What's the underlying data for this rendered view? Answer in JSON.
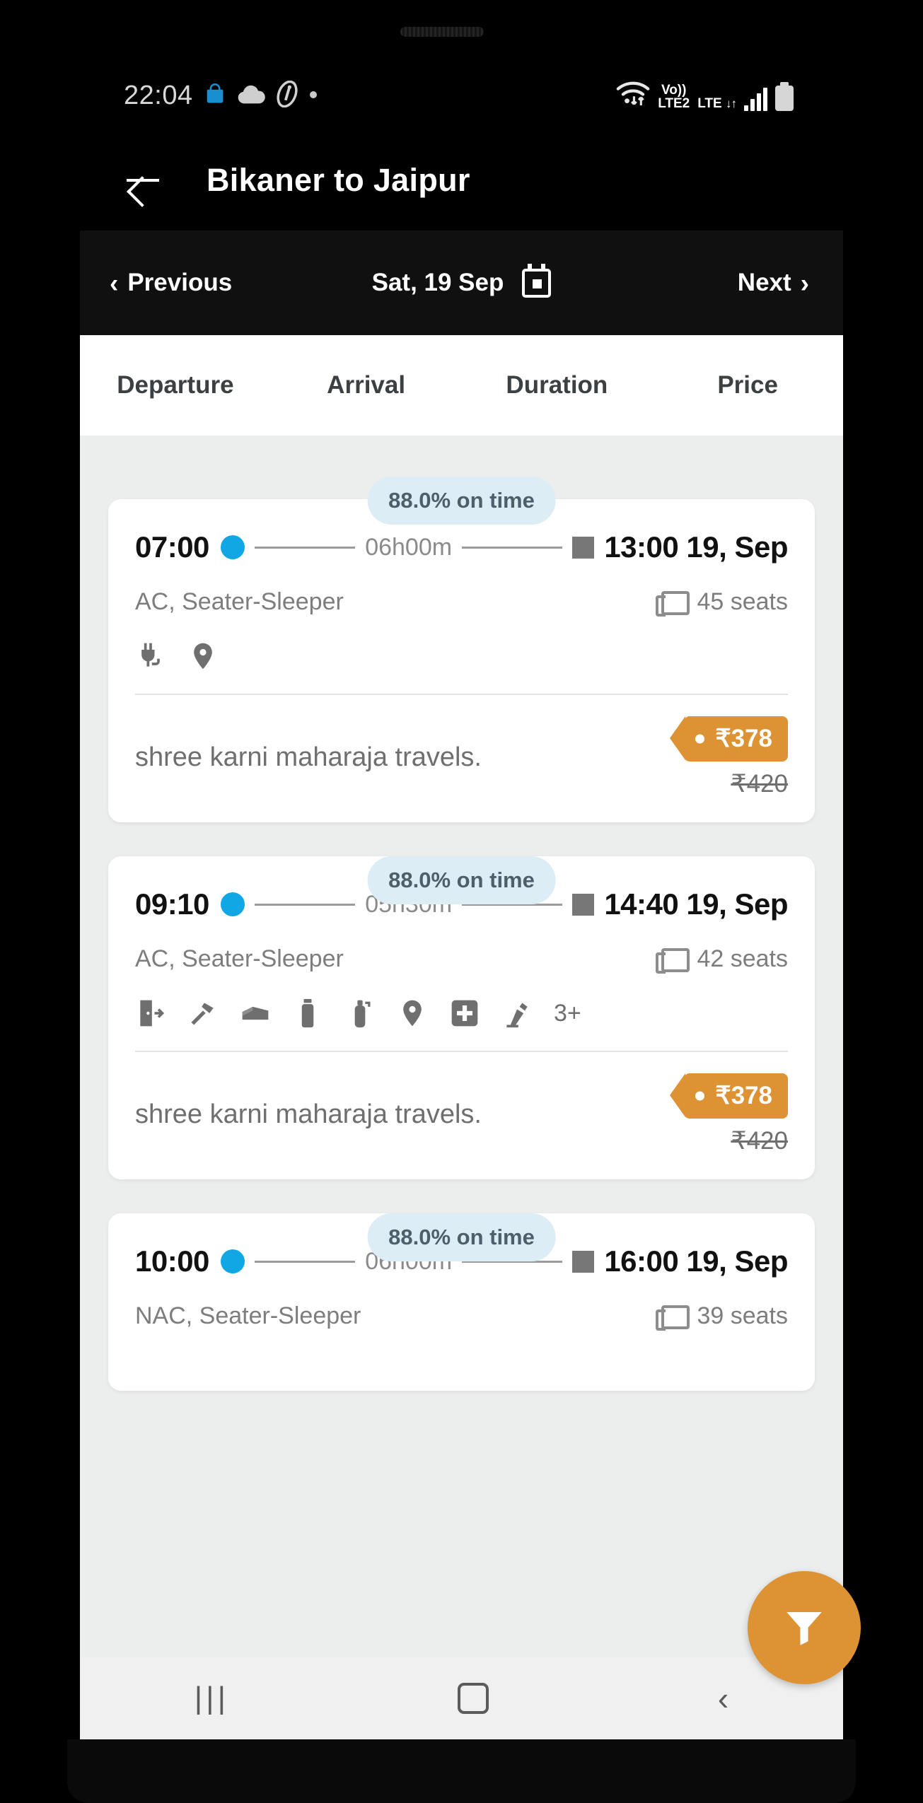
{
  "status_bar": {
    "time": "22:04",
    "left_icons": [
      "shopping-bag-icon",
      "cloud-icon",
      "brand-icon",
      "dot-icon"
    ],
    "right_icons": [
      "wifi-icon",
      "volte-icon",
      "lte-icon",
      "signal-bars-icon",
      "battery-icon"
    ],
    "volte_line1": "Vo))",
    "volte_line2": "LTE2",
    "lte_label": "LTE",
    "lte_arrows": "↓↑",
    "wifi_arrows": "↓↑"
  },
  "app_bar": {
    "back_icon": "back-arrow-icon",
    "title": "Bikaner to Jaipur"
  },
  "date_bar": {
    "previous_label": "Previous",
    "previous_chevron": "‹",
    "date_label": "Sat, 19 Sep",
    "calendar_icon": "calendar-icon",
    "next_label": "Next",
    "next_chevron": "›"
  },
  "sort_tabs": [
    {
      "label": "Departure"
    },
    {
      "label": "Arrival"
    },
    {
      "label": "Duration"
    },
    {
      "label": "Price"
    }
  ],
  "buses": [
    {
      "on_time_badge": "88.0% on time",
      "departure_time": "07:00",
      "duration": "06h00m",
      "arrival_time": "13:00 19, Sep",
      "bus_type": "AC, Seater-Sleeper",
      "seats": "45 seats",
      "amenities": [
        "charging-point-icon",
        "live-tracking-icon"
      ],
      "amenities_more": "",
      "operator": "shree karni maharaja travels.",
      "price": "₹378",
      "original_price": "₹420"
    },
    {
      "on_time_badge": "88.0% on time",
      "departure_time": "09:10",
      "duration": "05h30m",
      "arrival_time": "14:40 19, Sep",
      "bus_type": "AC, Seater-Sleeper",
      "seats": "42 seats",
      "amenities": [
        "emergency-exit-icon",
        "hammer-icon",
        "blanket-icon",
        "water-bottle-icon",
        "fire-extinguisher-icon",
        "live-tracking-icon",
        "first-aid-icon",
        "reading-light-icon"
      ],
      "amenities_more": "3+",
      "operator": "shree karni maharaja travels.",
      "price": "₹378",
      "original_price": "₹420"
    },
    {
      "on_time_badge": "88.0% on time",
      "departure_time": "10:00",
      "duration": "06h00m",
      "arrival_time": "16:00 19, Sep",
      "bus_type": "NAC, Seater-Sleeper",
      "seats": "39 seats",
      "amenities": [],
      "amenities_more": "",
      "operator": "",
      "price": "",
      "original_price": ""
    }
  ],
  "filter_fab": {
    "icon": "filter-funnel-icon"
  },
  "nav_bar": {
    "recents_icon": "|||",
    "home_icon": "home-square-icon",
    "back_icon": "‹"
  },
  "colors": {
    "accent_orange": "#dd9333",
    "dot_blue": "#11a7e5",
    "badge_bg": "#dcedf6",
    "badge_text": "#4c5f6b",
    "page_bg": "#eceded"
  }
}
